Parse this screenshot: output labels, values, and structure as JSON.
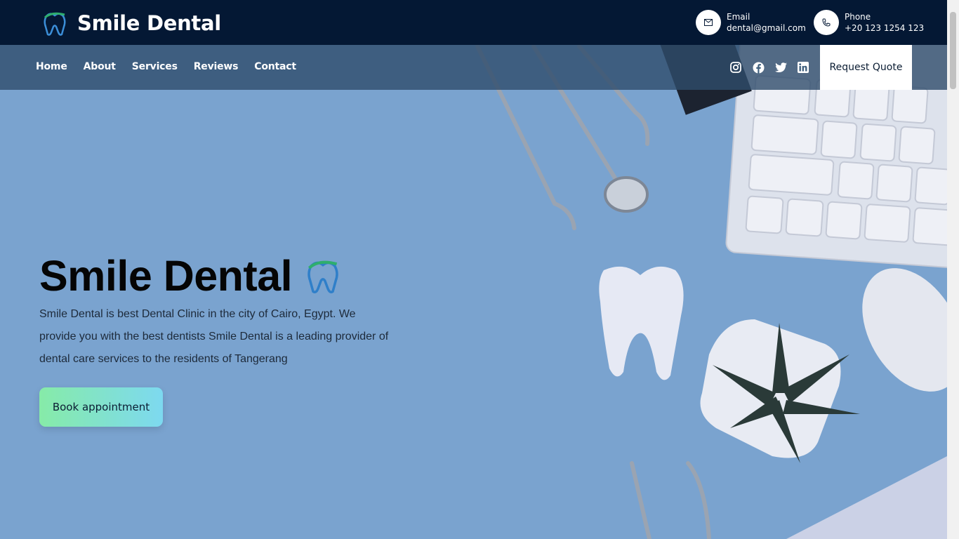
{
  "brand": {
    "name": "Smile Dental"
  },
  "contacts": [
    {
      "label": "Email",
      "value": "dental@gmail.com",
      "icon": "mail-icon"
    },
    {
      "label": "Phone",
      "value": "+20 123 1254 123",
      "icon": "phone-icon"
    }
  ],
  "nav": {
    "items": [
      "Home",
      "About",
      "Services",
      "Reviews",
      "Contact"
    ]
  },
  "socials": [
    "instagram-icon",
    "facebook-icon",
    "twitter-icon",
    "linkedin-icon"
  ],
  "quote_button": "Request Quote",
  "hero": {
    "title": "Smile Dental",
    "description": "Smile Dental is best Dental Clinic in the city of Cairo, Egypt. We provide you with the best dentists Smile Dental is a leading provider of dental care services to the residents of Tangerang",
    "cta": "Book appointment"
  },
  "colors": {
    "topbar": "#041834",
    "hero_bg": "#7aa3cf",
    "cta_gradient_start": "#86eba8",
    "cta_gradient_end": "#7dd9f0"
  }
}
